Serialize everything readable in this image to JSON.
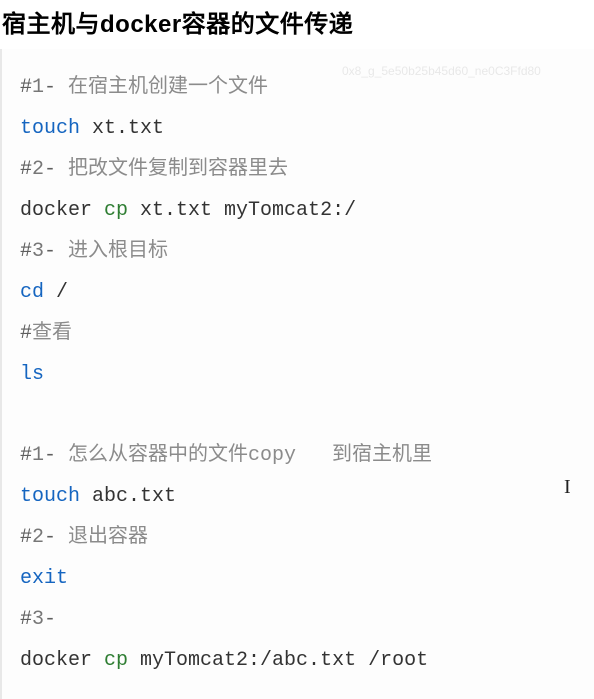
{
  "heading": "宿主机与docker容器的文件传递",
  "code": {
    "l1_hash": "#",
    "l1_num": "1",
    "l1_dash": "-",
    "l1_text": " 在宿主机创建一个文件",
    "l2_kw": "touch",
    "l2_arg": " xt.txt",
    "l3_hash": "#",
    "l3_num": "2",
    "l3_dash": "-",
    "l3_text": " 把改文件复制到容器里去",
    "l4_cmd": "docker ",
    "l4_cp": "cp",
    "l4_arg": " xt.txt myTomcat2:/",
    "l5_hash": "#",
    "l5_num": "3",
    "l5_dash": "-",
    "l5_text": " 进入根目标",
    "l6_kw": "cd",
    "l6_arg": " /",
    "l7_hash": "#",
    "l7_text": "查看",
    "l8_kw": "ls",
    "l9_hash": "#",
    "l9_num": "1",
    "l9_dash": "-",
    "l9_text": " 怎么从容器中的文件copy   到宿主机里",
    "l10_kw": "touch",
    "l10_arg": " abc.txt",
    "l11_hash": "#",
    "l11_num": "2",
    "l11_dash": "-",
    "l11_text": " 退出容器",
    "l12_kw": "exit",
    "l13_hash": "#",
    "l13_num": "3",
    "l13_dash": "-",
    "l14_cmd": "docker ",
    "l14_cp": "cp",
    "l14_arg": " myTomcat2:/abc.txt /root"
  },
  "watermark": "0x8_g_5e50b25b45d60_ne0C3Ffd80",
  "cursor_glyph": "I"
}
